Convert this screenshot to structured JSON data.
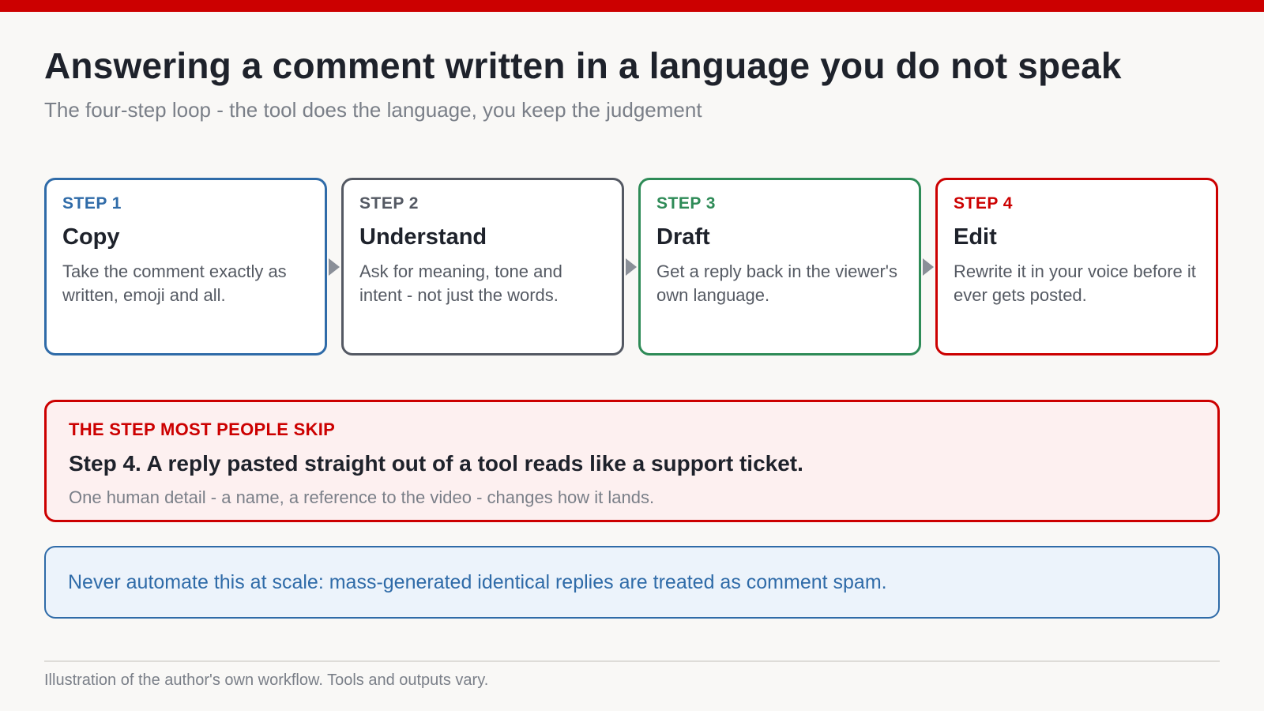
{
  "header": {
    "title": "Answering a comment written in a language you do not speak",
    "subtitle": "The four-step loop - the tool does the language, you keep the judgement"
  },
  "steps": [
    {
      "label": "STEP 1",
      "title": "Copy",
      "desc": "Take the comment exactly as written, emoji and all.",
      "color": "#2f6ba8"
    },
    {
      "label": "STEP 2",
      "title": "Understand",
      "desc": "Ask for meaning, tone and intent - not just the words.",
      "color": "#545963"
    },
    {
      "label": "STEP 3",
      "title": "Draft",
      "desc": "Get a reply back in the viewer's own language.",
      "color": "#2e8b57"
    },
    {
      "label": "STEP 4",
      "title": "Edit",
      "desc": "Rewrite it in your voice before it ever gets posted.",
      "color": "#cc0000"
    }
  ],
  "callout": {
    "label": "THE STEP MOST PEOPLE SKIP",
    "heading": "Step 4. A reply pasted straight out of a tool reads like a support ticket.",
    "sub": "One human detail - a name, a reference to the video - changes how it lands."
  },
  "note": {
    "text": "Never automate this at scale: mass-generated identical replies are treated as comment spam."
  },
  "footer": {
    "text": "Illustration of the author's own workflow. Tools and outputs vary."
  },
  "colors": {
    "accent": "#cc0000",
    "note_blue": "#2f6ba8"
  }
}
